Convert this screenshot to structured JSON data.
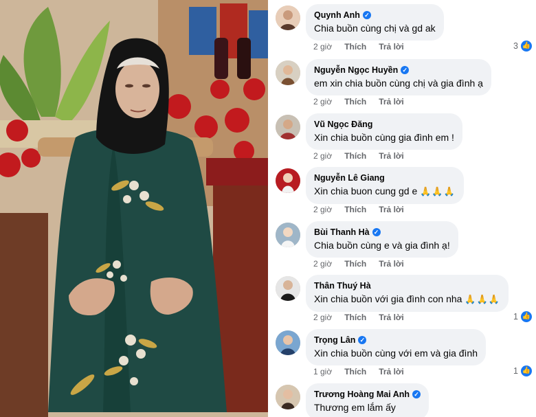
{
  "photo": {
    "icon": "photo-elderly-woman-ao-dai"
  },
  "comments": [
    {
      "author": "Quynh Anh",
      "verified": true,
      "text": "Chia buồn cùng chị và gd ak",
      "time": "2 giờ",
      "like_label": "Thích",
      "reply_label": "Trả lời",
      "reactions": "3"
    },
    {
      "author": "Nguyễn Ngọc Huyền",
      "verified": true,
      "text": "em xin chia buồn cùng chị và gia đình ạ",
      "time": "2 giờ",
      "like_label": "Thích",
      "reply_label": "Trả lời",
      "reactions": ""
    },
    {
      "author": "Vũ Ngọc Đăng",
      "verified": false,
      "text": "Xin chia buồn cùng gia đình em !",
      "time": "2 giờ",
      "like_label": "Thích",
      "reply_label": "Trả lời",
      "reactions": ""
    },
    {
      "author": "Nguyễn Lê Giang",
      "verified": false,
      "text": "Xin chia buon cung gd e",
      "emoji": "🙏🙏🙏",
      "time": "2 giờ",
      "like_label": "Thích",
      "reply_label": "Trả lời",
      "reactions": ""
    },
    {
      "author": "Bùi Thanh Hà",
      "verified": true,
      "text": "Chia buồn cùng e và gia đình ạ!",
      "time": "2 giờ",
      "like_label": "Thích",
      "reply_label": "Trả lời",
      "reactions": ""
    },
    {
      "author": "Thân Thuý Hà",
      "verified": false,
      "text": "Xin chia buồn với gia đình con nha",
      "emoji": "🙏🙏🙏",
      "time": "2 giờ",
      "like_label": "Thích",
      "reply_label": "Trả lời",
      "reactions": "1"
    },
    {
      "author": "Trọng Lân",
      "verified": true,
      "text": "Xin chia buồn cùng với em và gia đình",
      "time": "1 giờ",
      "like_label": "Thích",
      "reply_label": "Trả lời",
      "reactions": "1"
    },
    {
      "author": "Trương Hoàng Mai Anh",
      "verified": true,
      "text": "Thương em lắm ấy",
      "time": "",
      "like_label": "",
      "reply_label": "",
      "reactions": ""
    }
  ],
  "colors": {
    "accent": "#1877f2",
    "bubble": "#f0f2f5",
    "muted": "#65676b",
    "ao_dai": "#1f4a44"
  }
}
